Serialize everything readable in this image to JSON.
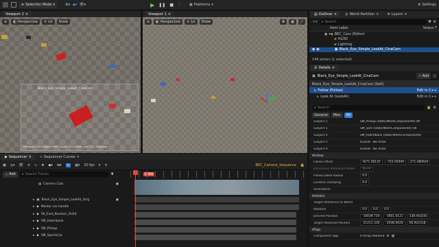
{
  "toolbar": {
    "selection_mode": "Selection Mode",
    "platforms": "Platforms",
    "settings": "Settings"
  },
  "viewport2": {
    "tab": "Viewport 2",
    "perspective": "Perspective",
    "lit": "Lit",
    "show": "Show",
    "pip_label": "Black_Eye_Simple_LookAt_CineCam",
    "camera_info": "Filmback: 16:9 Digital Film | Zoom: 19.23mm | Av: 2.8 | Squeeze:"
  },
  "viewport1": {
    "tab": "Viewport 1",
    "perspective": "Perspective",
    "lit": "Lit",
    "show": "Show"
  },
  "outliner": {
    "tabs": [
      "Outliner",
      "World Partition",
      "Layers"
    ],
    "search_placeholder": "Search",
    "col_label": "Item Label",
    "col_type": "Seque T",
    "items": [
      {
        "label": "BEC_Cars (Editor)",
        "indent": 1
      },
      {
        "label": "HLOD",
        "indent": 2
      },
      {
        "label": "Lighting",
        "indent": 2
      },
      {
        "label": "Black_Eye_Simple_LookAt_CineCam",
        "indent": 2,
        "selected": true
      }
    ],
    "status": "146 actors (1 selected)"
  },
  "details": {
    "tab": "Details",
    "actor_name": "Black_Eye_Simple_LookAt_CineCam",
    "add": "Add",
    "components": [
      {
        "label": "Black_Eye_Simple_LookAt_CineCam (Self)",
        "edit": ""
      },
      {
        "label": "Follow (Follow)",
        "edit": "Edit in C++",
        "selected": true
      },
      {
        "label": "Look At (LookAt)",
        "edit": "Edit in C++"
      }
    ],
    "search_placeholder": "Search",
    "filter_tabs": [
      "General",
      "Misc",
      "All"
    ],
    "active_filter": "All",
    "subjects": [
      {
        "label": "Subject 2",
        "value": "SM_Pickup (StaticMeshComponent0) [M"
      },
      {
        "label": "Subject 3",
        "value": "SM_SUV (StaticMeshComponent0) [W"
      },
      {
        "label": "Subject 4",
        "value": "SM_Hatchback (StaticMeshComponent0)"
      },
      {
        "label": "Subject 5",
        "value": "Invalid - No Actor"
      },
      {
        "label": "Subject 6",
        "value": "Invalid - No Actor"
      }
    ],
    "follow_section": "Follow",
    "follow_offset_label": "Follow Offset",
    "follow_offset": [
      "1671.58135",
      "-752.05009",
      "271.480924"
    ],
    "dimension_mode_label": "Dimension Reference Mode",
    "dimension_mode": "World",
    "dwell_label": "Follow Dwell Radius",
    "dwell": "0.0",
    "damping_label": "Location Damping",
    "damping": "0.0",
    "orientation_label": "Orientation",
    "hidden_section": "Hidden",
    "target_ref_label": "Target Reference to World",
    "rotation_label": "Rotation",
    "rotation": [
      "0.0",
      "0.0",
      "0.0"
    ],
    "desired_label": "Desired Position",
    "desired": [
      "-10039.734",
      "-3601.0121",
      "338.403241"
    ],
    "resolved_label": "Target Resolved Position",
    "resolved": [
      "-21211.316",
      "-2938.9020",
      "66.922318"
    ],
    "tags_section": "Tags",
    "component_tags_label": "Component Tags",
    "component_tags": "0 Array element"
  },
  "sequencer": {
    "tab": "Sequencer",
    "curves_tab": "Sequencer Curves",
    "fps": "30 fps",
    "sequence_name": "BEC_Camera_Sequence",
    "add": "Add",
    "search_placeholder": "Search Tracks",
    "frame_marker": "0000",
    "tracks": [
      {
        "label": "Camera Cuts",
        "indent": 0
      },
      {
        "label": "",
        "indent": 0
      },
      {
        "label": "Black_Eye_Simple_LookAt_Orig",
        "indent": 1
      },
      {
        "label": "Master car handle",
        "indent": 1
      },
      {
        "label": "SK_East_Bomber_SU24",
        "indent": 1
      },
      {
        "label": "SM_Hatchback",
        "indent": 1
      },
      {
        "label": "SM_Pickup",
        "indent": 1
      },
      {
        "label": "SM_SportsCar",
        "indent": 1
      }
    ]
  },
  "colors": {
    "accent_blue": "#2e7bd6",
    "playhead": "#e04a3a",
    "selected_row": "#1e4f8c"
  }
}
